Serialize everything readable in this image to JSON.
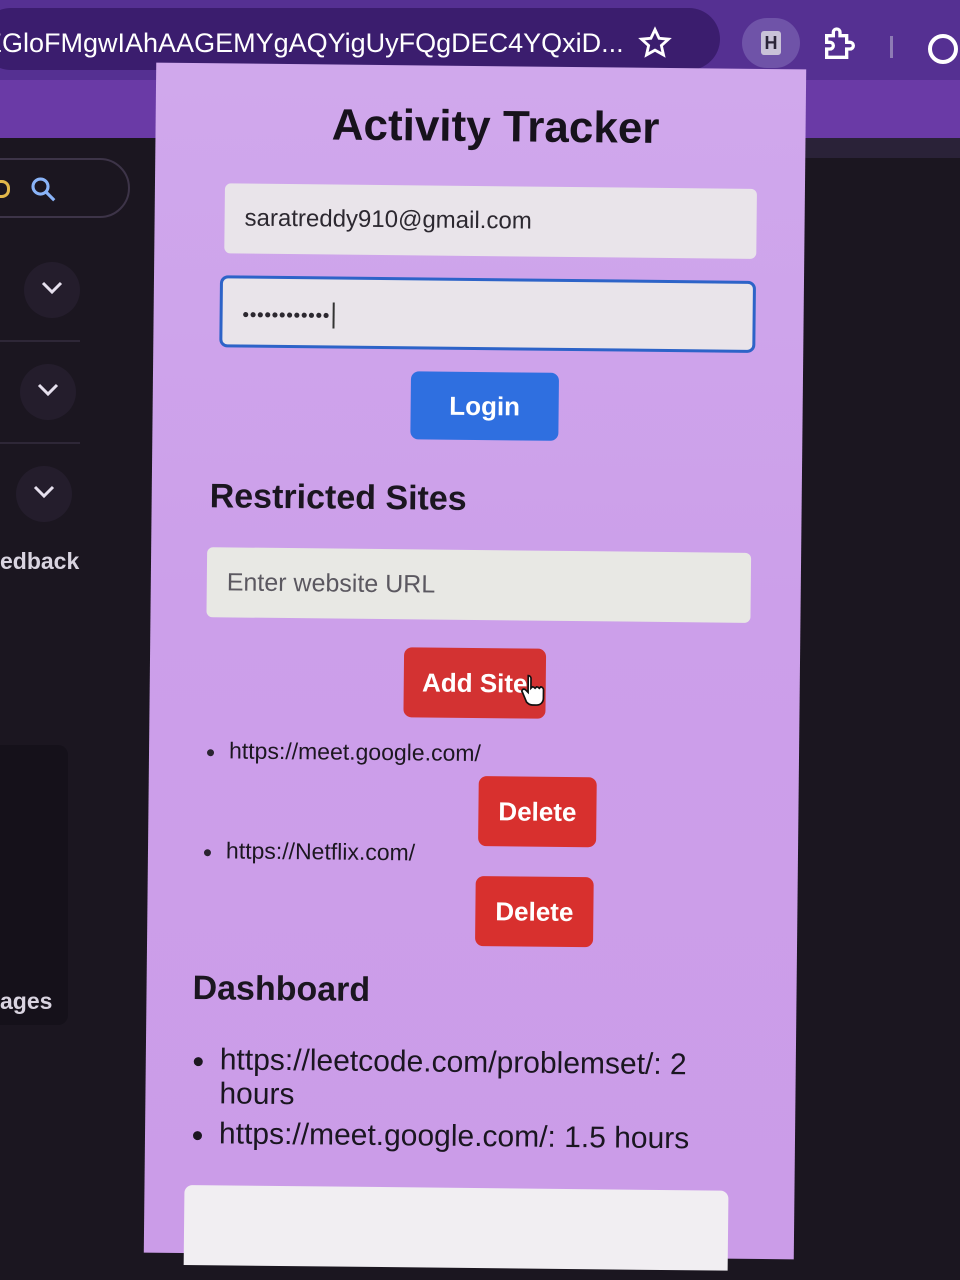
{
  "browser": {
    "url": "EGloFMgwIAhAAGEMYgAQYigUyFQgDEC4YQxiD...",
    "profile_initial": "H"
  },
  "background_page": {
    "label_feedback": "edback",
    "label_pages": "ages"
  },
  "popup": {
    "title": "Activity Tracker",
    "email_value": "saratreddy910@gmail.com",
    "password_value": "••••••••••••",
    "login_label": "Login",
    "restricted_heading": "Restricted Sites",
    "url_placeholder": "Enter website URL",
    "add_site_label": "Add Site",
    "restricted_sites": [
      {
        "url": "https://meet.google.com/",
        "delete_label": "Delete"
      },
      {
        "url": "https://Netflix.com/",
        "delete_label": "Delete"
      }
    ],
    "dashboard_heading": "Dashboard",
    "dashboard_items": [
      {
        "text": "https://leetcode.com/problemset/: 2 hours"
      },
      {
        "text": "https://meet.google.com/: 1.5 hours"
      }
    ]
  },
  "colors": {
    "popup_bg": "#cc9fea",
    "login_button": "#2f6fe0",
    "danger_button": "#d33232",
    "chrome_bar": "#553092"
  }
}
